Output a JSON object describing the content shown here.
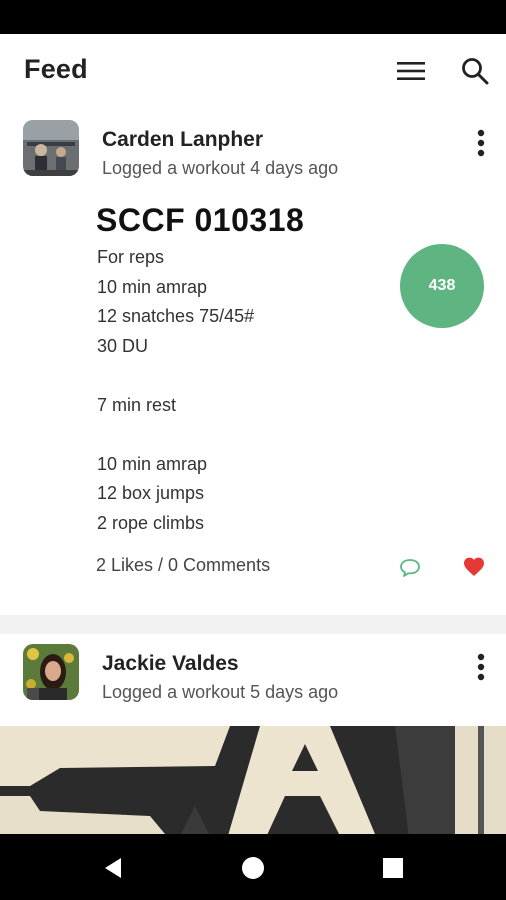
{
  "app_bar": {
    "title": "Feed",
    "icons": [
      "menu-icon",
      "search-icon"
    ]
  },
  "feed": [
    {
      "user_name": "Carden Lanpher",
      "subtitle": "Logged a workout 4 days ago",
      "workout_title": "SCCF 010318",
      "workout_lines": [
        "For reps",
        "10 min amrap",
        "12 snatches 75/45#",
        "30 DU",
        "",
        "7 min rest",
        "",
        "10 min amrap",
        "12 box jumps",
        "2 rope climbs"
      ],
      "score": "438",
      "likes_comments": "2 Likes / 0 Comments",
      "liked": true
    },
    {
      "user_name": "Jackie Valdes",
      "subtitle": "Logged a workout 5 days ago"
    }
  ],
  "colors": {
    "score_badge": "#5fb581",
    "comment_icon": "#5fb581",
    "heart_icon": "#e53935",
    "status_bar": "#000000",
    "nav_bar": "#000000"
  },
  "nav": {
    "icons": [
      "back-icon",
      "home-icon",
      "recents-icon"
    ]
  }
}
